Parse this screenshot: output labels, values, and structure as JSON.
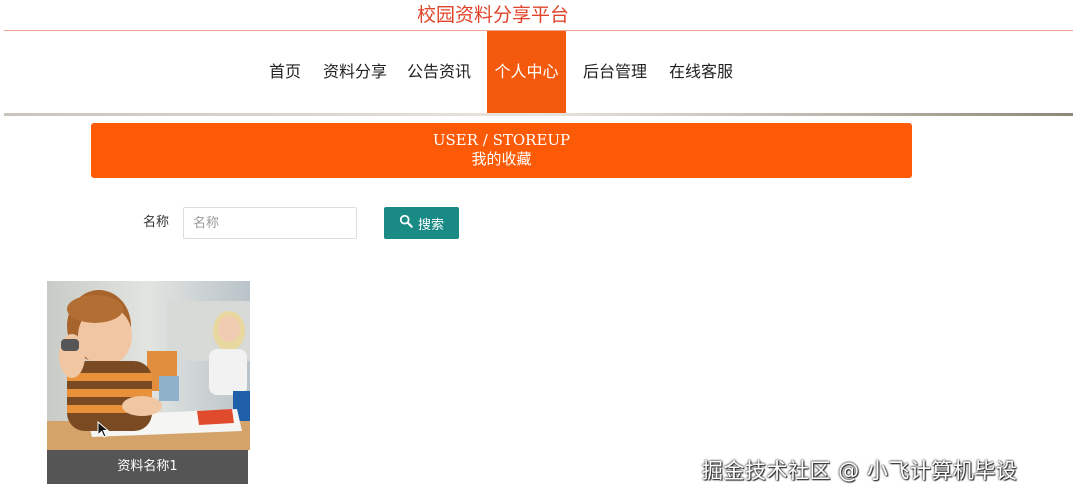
{
  "site": {
    "title": "校园资料分享平台"
  },
  "nav": {
    "items": [
      {
        "label": "首页",
        "active": false
      },
      {
        "label": "资料分享",
        "active": false
      },
      {
        "label": "公告资讯",
        "active": false
      },
      {
        "label": "个人中心",
        "active": true
      },
      {
        "label": "后台管理",
        "active": false
      },
      {
        "label": "在线客服",
        "active": false
      }
    ]
  },
  "banner": {
    "en": "USER / STOREUP",
    "cn": "我的收藏"
  },
  "search": {
    "label": "名称",
    "placeholder": "名称",
    "value": "",
    "button_label": "搜索",
    "button_icon": "search-icon"
  },
  "cards": [
    {
      "caption": "资料名称1",
      "image": "photo of boy studying at desk in classroom"
    }
  ],
  "watermark": "掘金技术社区 @ 小飞计算机毕设",
  "colors": {
    "title": "#e0442a",
    "nav_active": "#f35a0e",
    "banner": "#fc5a06",
    "search_button": "#1a8a85",
    "card_caption": "#555555"
  }
}
